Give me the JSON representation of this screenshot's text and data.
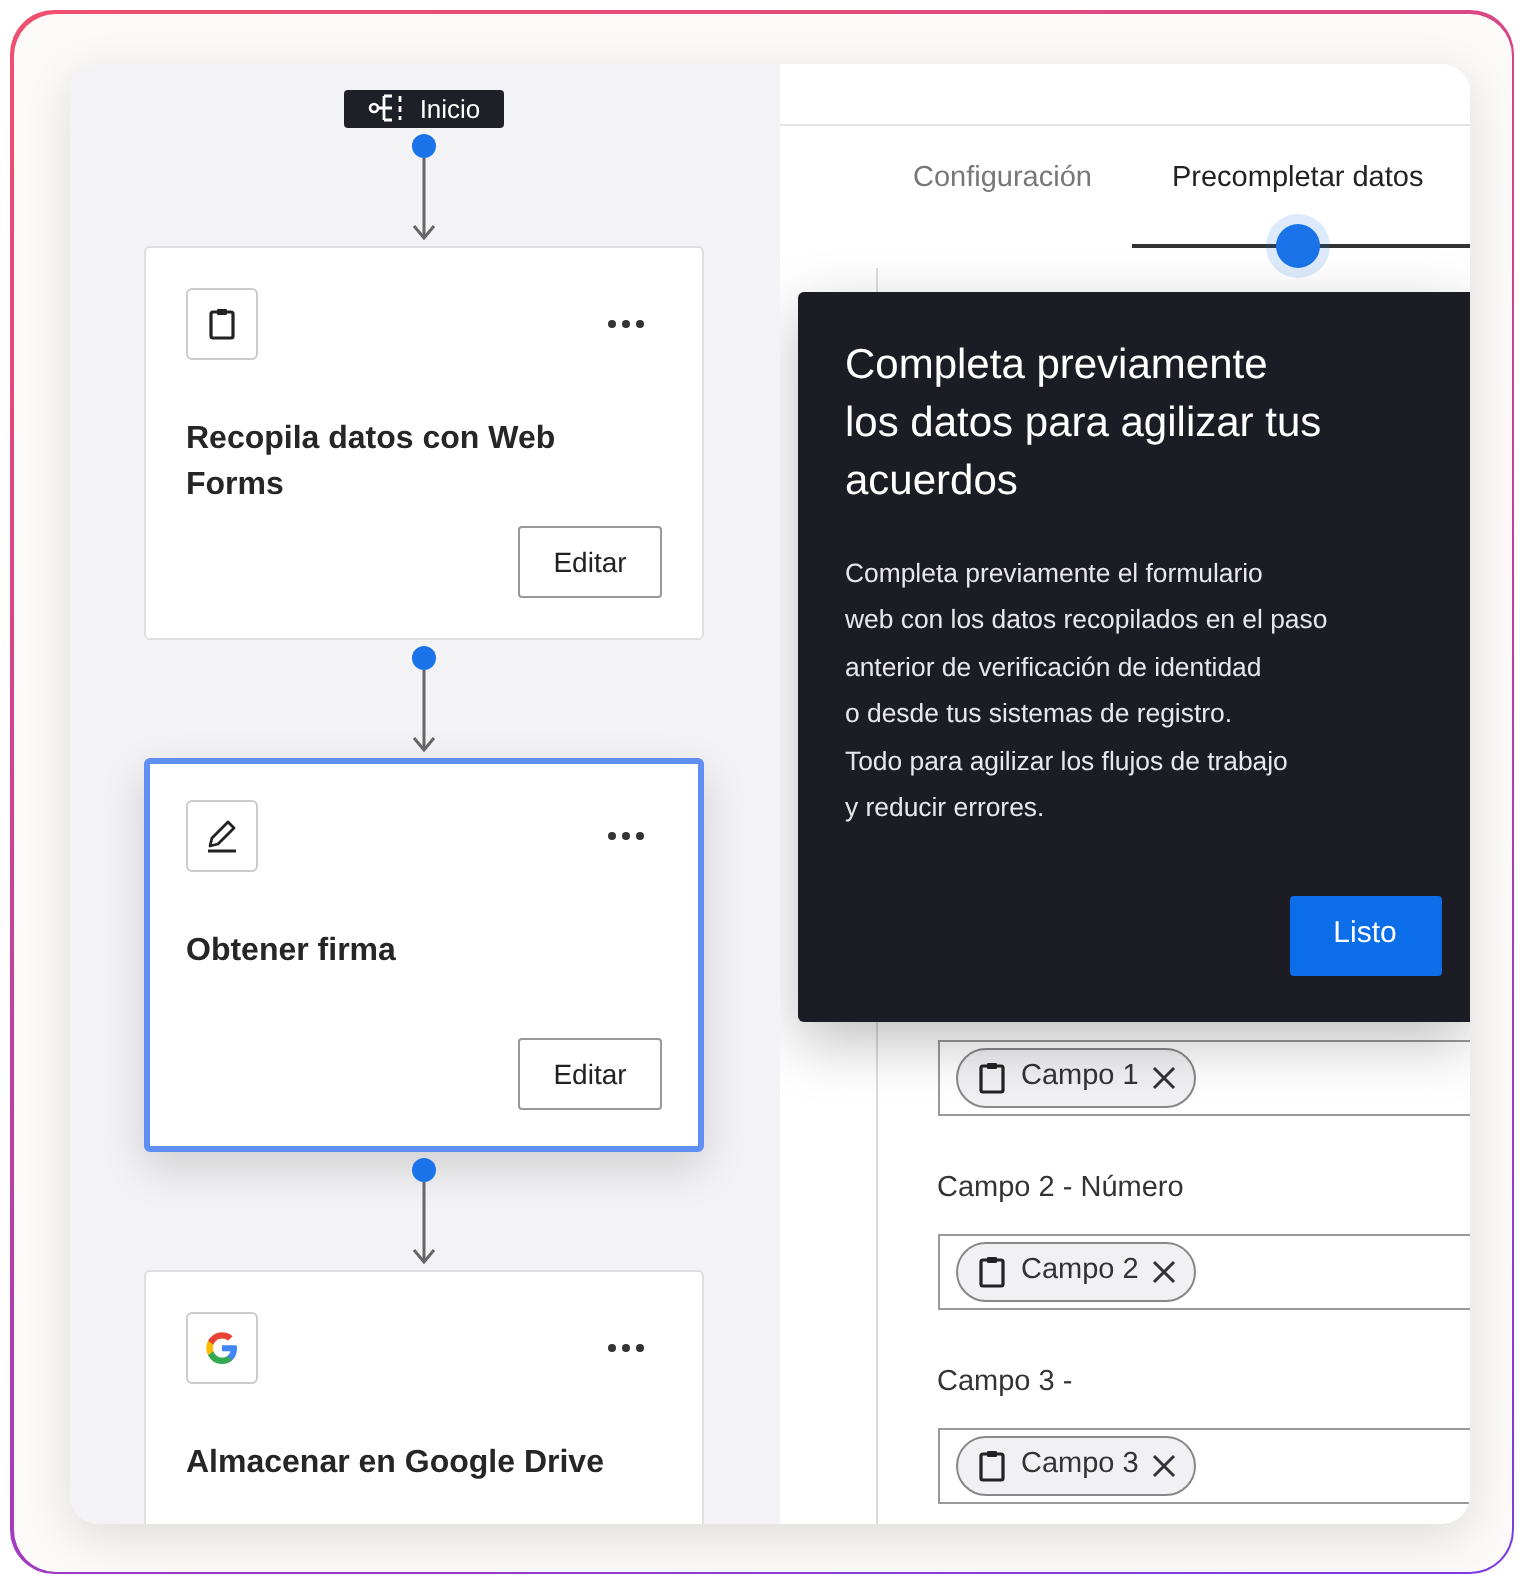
{
  "start": {
    "label": "Inicio"
  },
  "steps": [
    {
      "kind": "clipboard",
      "title": "Recopila datos con Web Forms",
      "button": "Editar",
      "selected": false
    },
    {
      "kind": "pen",
      "title": "Obtener firma",
      "button": "Editar",
      "selected": true
    },
    {
      "kind": "google",
      "title": "Almacenar en Google Drive",
      "selected": false
    }
  ],
  "tabs": [
    {
      "label": "Configuración",
      "selected": false
    },
    {
      "label": "Precompletar datos",
      "selected": true
    }
  ],
  "tooltip": {
    "title": "Completa previamente los datos para agilizar tus acuerdos",
    "body": "Completa previamente el formulario\nweb con los datos recopilados en el paso\nanterior de verificación de identidad\no desde tus sistemas de registro.\nTodo para agilizar los flujos de trabajo\ny reducir errores.",
    "button": "Listo"
  },
  "fields": [
    {
      "chip": "Campo 1"
    },
    {
      "label": "Campo 2 - Número",
      "chip": "Campo 2"
    },
    {
      "label": "Campo 3 -",
      "chip": "Campo 3"
    }
  ]
}
